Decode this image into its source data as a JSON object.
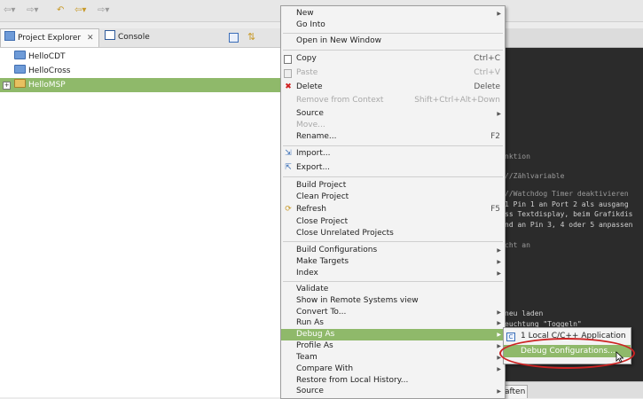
{
  "views": {
    "explorer_tab": "Project Explorer",
    "console_tab": "Console"
  },
  "explorer": {
    "items": [
      {
        "label": "HelloCDT"
      },
      {
        "label": "HelloCross"
      },
      {
        "label": "HelloMSP"
      }
    ]
  },
  "context_menu": {
    "items": [
      {
        "label": "New",
        "submenu": true
      },
      {
        "label": "Go Into"
      },
      {
        "label": "Open in New Window"
      },
      {
        "label": "Copy",
        "shortcut": "Ctrl+C",
        "icon": "copy-icon"
      },
      {
        "label": "Paste",
        "shortcut": "Ctrl+V",
        "disabled": true,
        "icon": "paste-icon"
      },
      {
        "label": "Delete",
        "shortcut": "Delete",
        "icon": "delete-icon"
      },
      {
        "label": "Remove from Context",
        "shortcut": "Shift+Ctrl+Alt+Down",
        "disabled": true
      },
      {
        "label": "Source",
        "submenu": true
      },
      {
        "label": "Move...",
        "disabled": true
      },
      {
        "label": "Rename...",
        "shortcut": "F2"
      },
      {
        "label": "Import...",
        "icon": "import-icon"
      },
      {
        "label": "Export...",
        "icon": "export-icon"
      },
      {
        "label": "Build Project"
      },
      {
        "label": "Clean Project"
      },
      {
        "label": "Refresh",
        "shortcut": "F5",
        "icon": "refresh-icon"
      },
      {
        "label": "Close Project"
      },
      {
        "label": "Close Unrelated Projects"
      },
      {
        "label": "Build Configurations",
        "submenu": true
      },
      {
        "label": "Make Targets",
        "submenu": true
      },
      {
        "label": "Index",
        "submenu": true
      },
      {
        "label": "Validate"
      },
      {
        "label": "Show in Remote Systems view"
      },
      {
        "label": "Convert To...",
        "submenu": true
      },
      {
        "label": "Run As",
        "submenu": true
      },
      {
        "label": "Debug As",
        "submenu": true,
        "highlighted": true
      },
      {
        "label": "Profile As",
        "submenu": true
      },
      {
        "label": "Team",
        "submenu": true
      },
      {
        "label": "Compare With",
        "submenu": true
      },
      {
        "label": "Restore from Local History..."
      },
      {
        "label": "Source",
        "submenu": true
      }
    ]
  },
  "debug_submenu": {
    "items": [
      {
        "label": "1 Local C/C++ Application",
        "icon": "c-application-icon"
      },
      {
        "label": "Debug Configurations...",
        "highlighted": true
      }
    ]
  },
  "editor": {
    "lines": [
      "nktion",
      "//Zählvariable",
      "//Watchdog Timer deaktivieren",
      "1 Pin 1 an Port 2 als ausgang",
      "ss Textdisplay, beim Grafikdis",
      "nd an Pin 3, 4 oder 5 anpassen",
      "cht an",
      "neu laden",
      "euchtung \"Toggeln\""
    ],
    "bottom_tab": "aften"
  },
  "colors": {
    "selection": "#8fb96a",
    "annotation": "#cc2222",
    "editor_bg": "#2b2b2b"
  }
}
